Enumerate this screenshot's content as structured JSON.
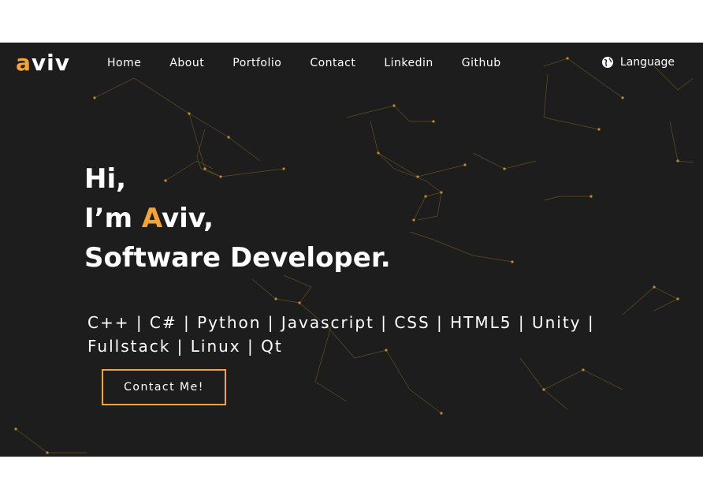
{
  "logo": {
    "prefix": "a",
    "rest": "viv"
  },
  "nav": [
    "Home",
    "About",
    "Portfolio",
    "Contact",
    "Linkedin",
    "Github"
  ],
  "language": {
    "label": "Language",
    "icon": "globe-icon"
  },
  "hero": {
    "line1": "Hi,",
    "line2_prefix": "I’m ",
    "line2_accent": "A",
    "line2_rest": "viv,",
    "line3": "Software Developer."
  },
  "skills": "C++ | C# | Python | Javascript | CSS | HTML5 | Unity | Fullstack | Linux | Qt",
  "cta": "Contact Me!",
  "colors": {
    "accent": "#f3a33a",
    "background": "#1d1d1d",
    "text": "#ffffff"
  }
}
